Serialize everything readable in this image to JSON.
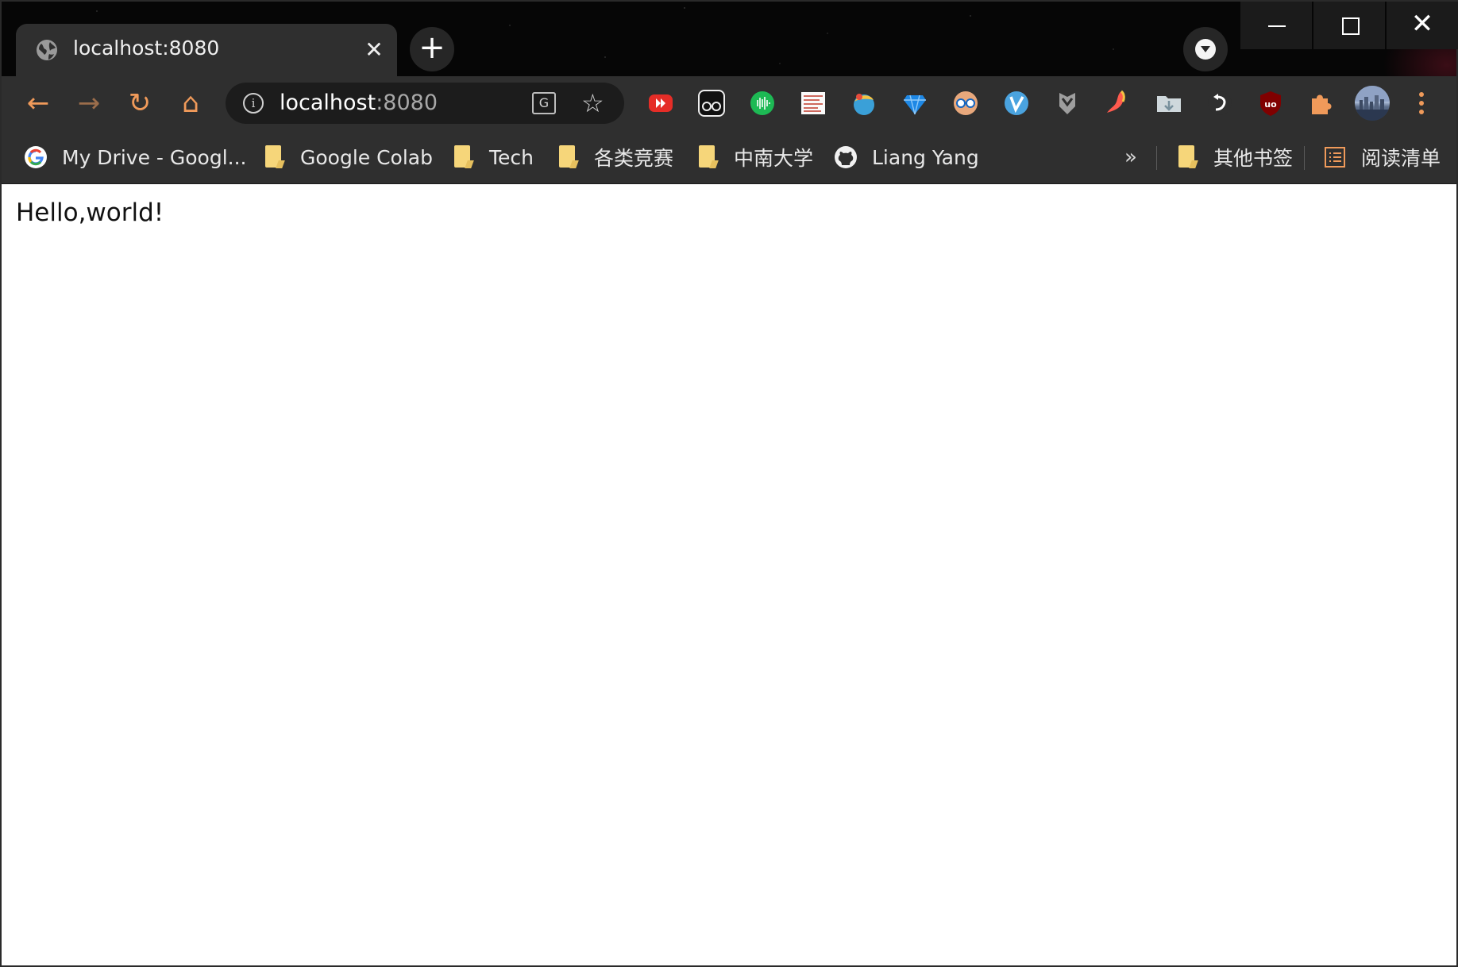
{
  "colors": {
    "accent": "#f09a5a",
    "toolbar_bg": "#2f2f2f",
    "titlebar_bg": "#060606",
    "omnibox_bg": "#1c1c1c"
  },
  "tab": {
    "title": "localhost:8080",
    "favicon_icon": "globe-icon",
    "close_glyph": "✕"
  },
  "new_tab": {
    "glyph": "+"
  },
  "window_controls": {
    "minimize_icon": "minimize-icon",
    "maximize_icon": "maximize-icon",
    "close_glyph": "✕"
  },
  "toolbar": {
    "back_glyph": "←",
    "forward_glyph": "→",
    "reload_glyph": "↻",
    "home_glyph": "⌂"
  },
  "omnibox": {
    "host": "localhost",
    "port": ":8080",
    "info_glyph": "i",
    "translate_glyph": "G",
    "star_glyph": "☆"
  },
  "extensions": [
    "youtube-icon",
    "owl-icon",
    "audio-wave-icon",
    "document-icon",
    "ball-icon",
    "gem-icon",
    "glasses-icon",
    "v-icon",
    "shield-icon",
    "boot-icon",
    "folder-download-icon",
    "turn-arrow-icon",
    "ublock-icon",
    "puzzle-icon"
  ],
  "bookmarks": {
    "items": [
      {
        "label": "My Drive - Googl...",
        "icon": "google-icon"
      },
      {
        "label": "Google Colab",
        "icon": "folder-icon"
      },
      {
        "label": "Tech",
        "icon": "folder-icon"
      },
      {
        "label": "各类竞赛",
        "icon": "folder-icon"
      },
      {
        "label": "中南大学",
        "icon": "folder-icon"
      },
      {
        "label": "Liang Yang",
        "icon": "github-icon"
      }
    ],
    "overflow_glyph": "»",
    "other": {
      "label": "其他书签",
      "icon": "folder-icon"
    },
    "reading_list": {
      "label": "阅读清单",
      "icon": "reading-list-icon"
    }
  },
  "page": {
    "text": "Hello,world!"
  }
}
